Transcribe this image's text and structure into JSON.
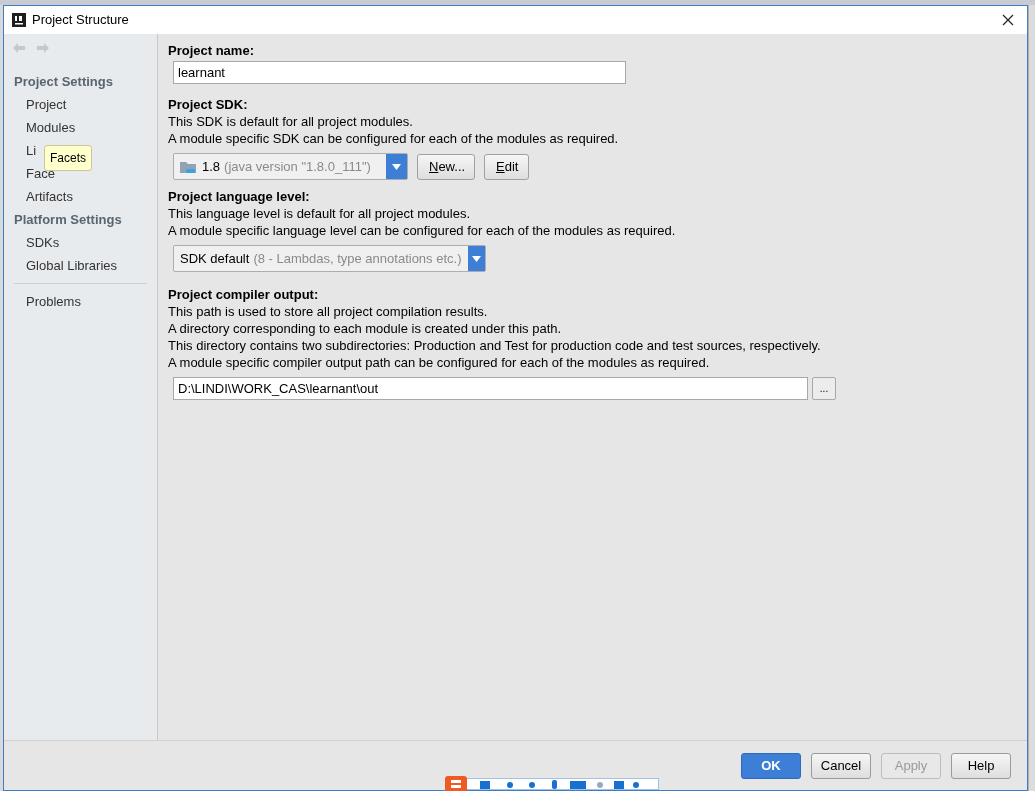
{
  "window": {
    "title": "Project Structure"
  },
  "navigation": {
    "back_disabled": true,
    "forward_disabled": true
  },
  "sidebar": {
    "sections": [
      {
        "heading": "Project Settings",
        "items": [
          {
            "label": "Project"
          },
          {
            "label": "Modules"
          },
          {
            "label": "Li"
          },
          {
            "label": "Face"
          },
          {
            "label": "Artifacts"
          }
        ]
      },
      {
        "heading": "Platform Settings",
        "items": [
          {
            "label": "SDKs"
          },
          {
            "label": "Global Libraries"
          }
        ]
      }
    ],
    "footer_items": [
      {
        "label": "Problems"
      }
    ],
    "tooltip": "Facets"
  },
  "content": {
    "project_name": {
      "label": "Project name:",
      "value": "learnant"
    },
    "sdk": {
      "label": "Project SDK:",
      "lines": [
        "This SDK is default for all project modules.",
        "A module specific SDK can be configured for each of the modules as required."
      ],
      "value": "1.8",
      "detail": "(java version \"1.8.0_111\")",
      "buttons": [
        {
          "mnemonic": "N",
          "rest": "ew..."
        },
        {
          "mnemonic": "E",
          "rest": "dit"
        }
      ]
    },
    "language_level": {
      "label": "Project language level:",
      "lines": [
        "This language level is default for all project modules.",
        "A module specific language level can be configured for each of the modules as required."
      ],
      "value": "SDK default",
      "detail": "(8 - Lambdas, type annotations etc.)"
    },
    "compiler_output": {
      "label": "Project compiler output:",
      "lines": [
        "This path is used to store all project compilation results.",
        "A directory corresponding to each module is created under this path.",
        "This directory contains two subdirectories: Production and Test for production code and test sources, respectively.",
        "A module specific compiler output path can be configured for each of the modules as required."
      ],
      "value": "D:\\LINDI\\WORK_CAS\\learnant\\out",
      "browse": "..."
    }
  },
  "buttons": [
    {
      "label": "OK",
      "default": true,
      "disabled": false
    },
    {
      "label": "Cancel",
      "default": false,
      "disabled": false
    },
    {
      "label": "Apply",
      "default": false,
      "disabled": true
    },
    {
      "label": "Help",
      "default": false,
      "disabled": false
    }
  ]
}
